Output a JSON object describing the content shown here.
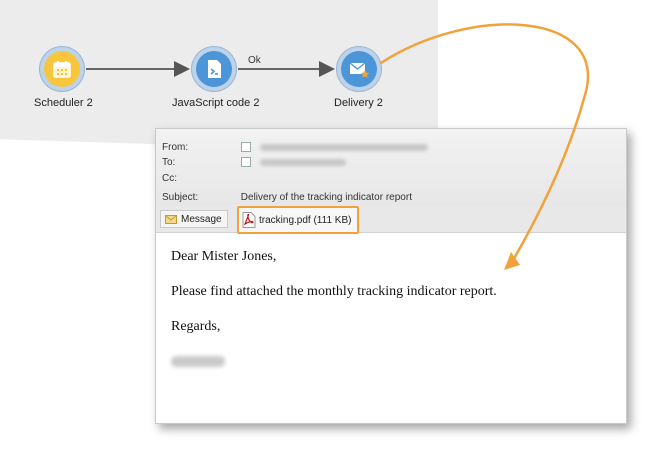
{
  "workflow": {
    "nodes": [
      {
        "label": "Scheduler 2",
        "icon": "calendar-icon"
      },
      {
        "label": "JavaScript code 2",
        "icon": "script-icon"
      },
      {
        "label": "Delivery 2",
        "icon": "envelope-star-icon"
      }
    ],
    "edge_label": "Ok"
  },
  "email": {
    "labels": {
      "from": "From:",
      "to": "To:",
      "cc": "Cc:",
      "subject": "Subject:"
    },
    "subject": "Delivery of the tracking indicator report",
    "message_tab": "Message",
    "attachment": {
      "name": "tracking.pdf (111 KB)",
      "icon": "pdf-icon"
    },
    "body": {
      "greeting": "Dear Mister Jones,",
      "text": "Please find attached the monthly tracking indicator report.",
      "closing": "Regards,"
    }
  },
  "colors": {
    "accent_orange": "#f2a23a",
    "node_blue": "#4c95d8",
    "node_yellow": "#f7c63d",
    "canvas_bg": "#ececec"
  }
}
